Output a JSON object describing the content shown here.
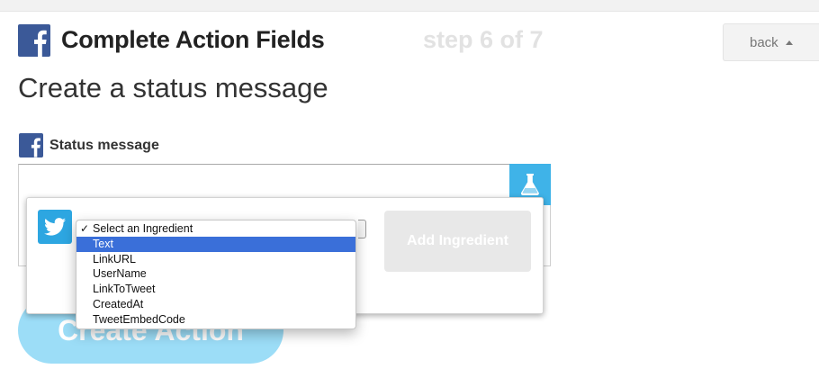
{
  "header": {
    "title": "Complete Action Fields",
    "step": "step 6 of 7",
    "back_label": "back"
  },
  "subtitle": "Create a status message",
  "field": {
    "label": "Status message",
    "value": ""
  },
  "ingredient_picker": {
    "add_button_label": "Add Ingredient",
    "options": [
      {
        "label": "Select an Ingredient",
        "checked": true
      },
      {
        "label": "Text",
        "highlighted": true
      },
      {
        "label": "LinkURL"
      },
      {
        "label": "UserName"
      },
      {
        "label": "LinkToTweet"
      },
      {
        "label": "CreatedAt"
      },
      {
        "label": "TweetEmbedCode"
      }
    ]
  },
  "create_button_label": "Create Action",
  "colors": {
    "facebook_blue": "#3b5998",
    "twitter_blue": "#2da6e1",
    "accent_blue": "#4cc2f1",
    "selection_blue": "#3a6fd9"
  },
  "icons": [
    "facebook-logo-icon",
    "flask-icon",
    "twitter-bird-icon",
    "chevron-up-icon",
    "checkmark-icon"
  ]
}
